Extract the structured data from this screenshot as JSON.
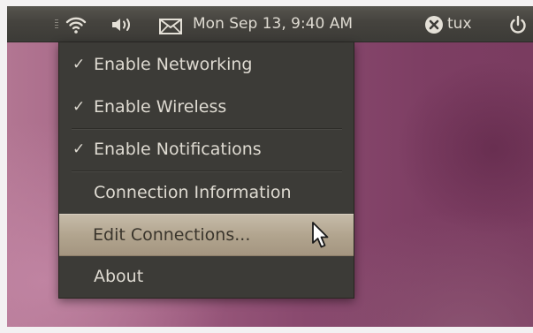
{
  "panel": {
    "clock": "Mon Sep 13,  9:40 AM",
    "user": "tux",
    "icons": {
      "grip": "panel-handle-grip",
      "network": "wifi-icon",
      "volume": "speaker-volume-icon",
      "mail": "envelope-icon",
      "status": "user-status-busy-icon",
      "power": "power-icon"
    }
  },
  "menu": {
    "items": [
      {
        "label": "Enable Networking",
        "checked": true,
        "check": "✓"
      },
      {
        "label": "Enable Wireless",
        "checked": true,
        "check": "✓"
      },
      {
        "label": "Enable Notifications",
        "checked": true,
        "check": "✓"
      },
      {
        "label": "Connection Information",
        "checked": false
      },
      {
        "label": "Edit Connections...",
        "checked": false,
        "highlighted": true
      },
      {
        "label": "About",
        "checked": false
      }
    ]
  },
  "colors": {
    "panel": "#3c3b37",
    "menu_bg": "#3c3b37",
    "menu_text": "#dfdbd2",
    "highlight": "#b2a58f",
    "wallpaper": "#8a4a6f"
  }
}
